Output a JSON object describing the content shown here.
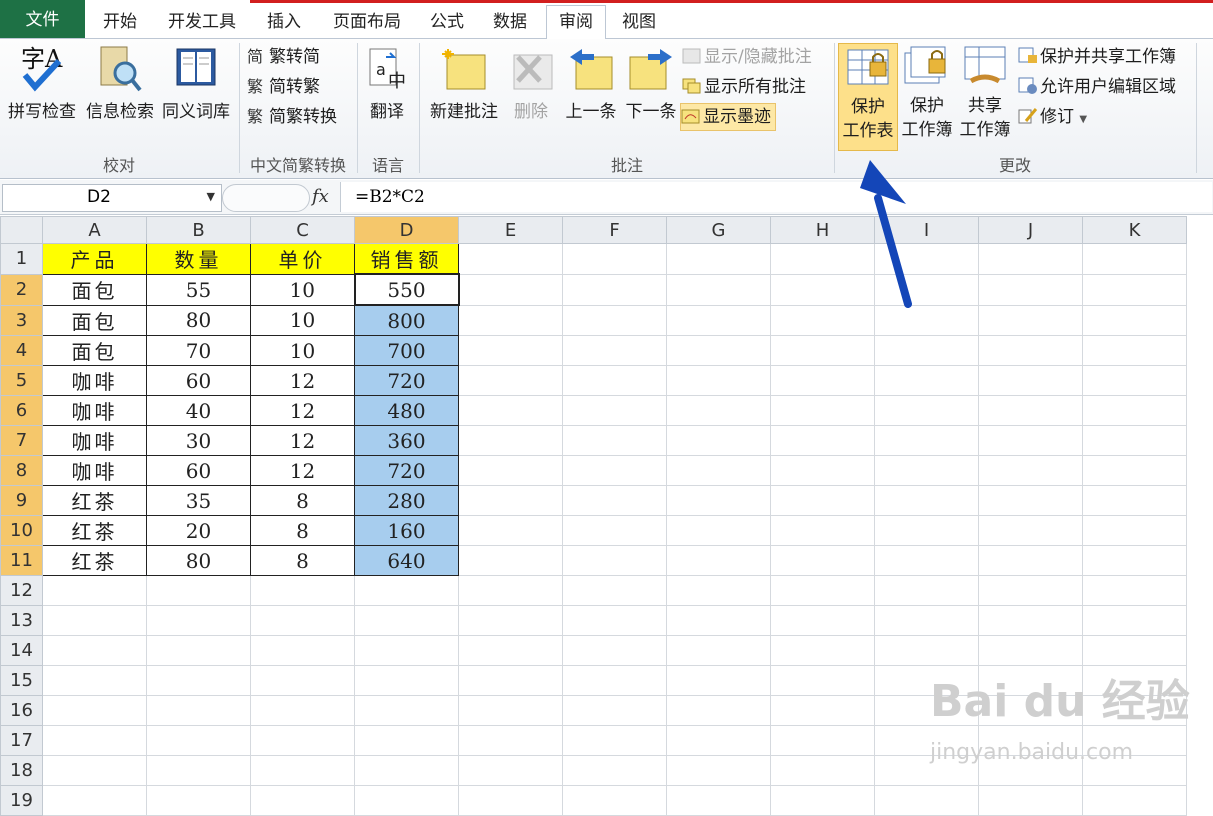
{
  "tabs": {
    "file": "文件",
    "home": "开始",
    "developer": "开发工具",
    "insert": "插入",
    "page_layout": "页面布局",
    "formulas": "公式",
    "data": "数据",
    "review": "审阅",
    "view": "视图"
  },
  "ribbon": {
    "proofing": {
      "spelling": "拼写检查",
      "research": "信息检索",
      "thesaurus": "同义词库",
      "label": "校对"
    },
    "chinese": {
      "to_simplified": "繁转简",
      "to_traditional": "简转繁",
      "convert": "简繁转换",
      "label": "中文简繁转换"
    },
    "language": {
      "translate": "翻译",
      "label": "语言"
    },
    "comments": {
      "new": "新建批注",
      "delete": "删除",
      "previous": "上一条",
      "next": "下一条",
      "show_hide": "显示/隐藏批注",
      "show_all": "显示所有批注",
      "show_ink": "显示墨迹",
      "label": "批注"
    },
    "changes": {
      "protect_sheet_1": "保护",
      "protect_sheet_2": "工作表",
      "protect_workbook_1": "保护",
      "protect_workbook_2": "工作簿",
      "share_workbook_1": "共享",
      "share_workbook_2": "工作簿",
      "protect_share": "保护并共享工作簿",
      "allow_edit": "允许用户编辑区域",
      "track_changes": "修订",
      "label": "更改"
    }
  },
  "formula_bar": {
    "name_box": "D2",
    "fx": "fx",
    "formula": "=B2*C2"
  },
  "columns": [
    "A",
    "B",
    "C",
    "D",
    "E",
    "F",
    "G",
    "H",
    "I",
    "J",
    "K"
  ],
  "rows": [
    "1",
    "2",
    "3",
    "4",
    "5",
    "6",
    "7",
    "8",
    "9",
    "10",
    "11",
    "12",
    "13",
    "14",
    "15",
    "16",
    "17",
    "18",
    "19"
  ],
  "table": {
    "headers": [
      "产品",
      "数量",
      "单价",
      "销售额"
    ],
    "rows": [
      [
        "面包",
        "55",
        "10",
        "550"
      ],
      [
        "面包",
        "80",
        "10",
        "800"
      ],
      [
        "面包",
        "70",
        "10",
        "700"
      ],
      [
        "咖啡",
        "60",
        "12",
        "720"
      ],
      [
        "咖啡",
        "40",
        "12",
        "480"
      ],
      [
        "咖啡",
        "30",
        "12",
        "360"
      ],
      [
        "咖啡",
        "60",
        "12",
        "720"
      ],
      [
        "红茶",
        "35",
        "8",
        "280"
      ],
      [
        "红茶",
        "20",
        "8",
        "160"
      ],
      [
        "红茶",
        "80",
        "8",
        "640"
      ]
    ]
  },
  "watermark": {
    "brand": "Bai du 经验",
    "url": "jingyan.baidu.com"
  },
  "colors": {
    "file_tab": "#1e7145",
    "header_fill": "#ffff00",
    "selection_fill": "#a7cdee",
    "arrow": "#1446b8"
  }
}
